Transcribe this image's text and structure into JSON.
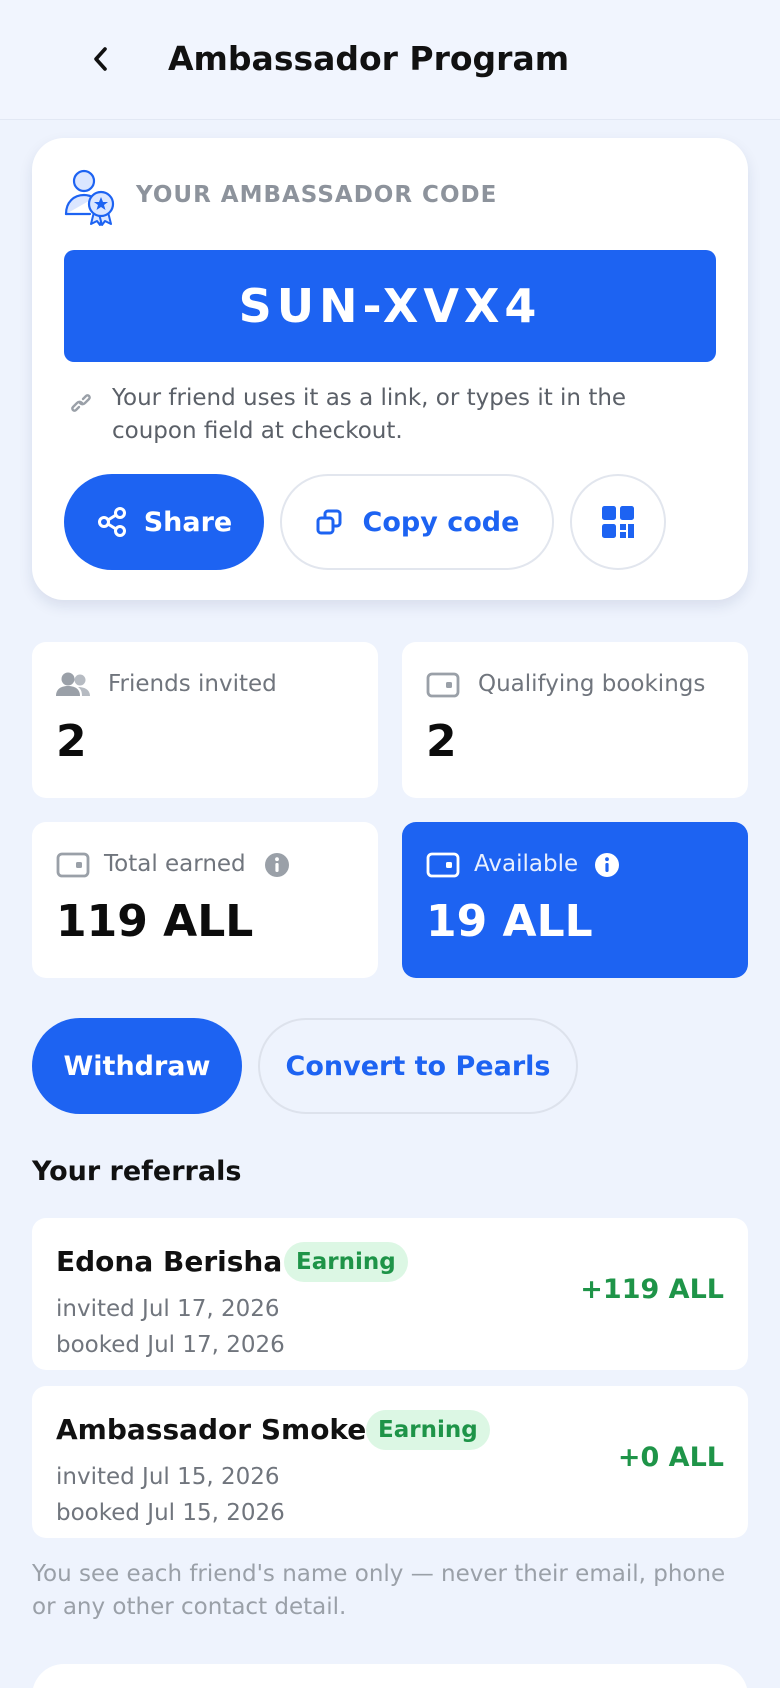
{
  "header": {
    "title": "Ambassador Program"
  },
  "code_card": {
    "label": "YOUR AMBASSADOR CODE",
    "code": "SUN-XVX4",
    "hint": "Your friend uses it as a link, or types it in the coupon field at checkout.",
    "share_label": "Share",
    "copy_label": "Copy code"
  },
  "stats": {
    "friends_invited": {
      "label": "Friends invited",
      "value": "2"
    },
    "qualifying_bookings": {
      "label": "Qualifying bookings",
      "value": "2"
    },
    "total_earned": {
      "label": "Total earned",
      "value": "119 ALL"
    },
    "available": {
      "label": "Available",
      "value": "19 ALL"
    }
  },
  "actions": {
    "withdraw_label": "Withdraw",
    "convert_label": "Convert to Pearls"
  },
  "referrals": {
    "title": "Your referrals",
    "items": [
      {
        "name": "Edona Berisha",
        "status": "Earning",
        "invited": "invited Jul 17, 2026",
        "booked": "booked Jul 17, 2026",
        "amount": "+119 ALL"
      },
      {
        "name": "Ambassador Smoke",
        "status": "Earning",
        "invited": "invited Jul 15, 2026",
        "booked": "booked Jul 15, 2026",
        "amount": "+0 ALL"
      }
    ]
  },
  "footnote": "You see each friend's name only — never their email, phone or any other contact detail.",
  "colors": {
    "accent": "#1d63f2",
    "success": "#1e9448",
    "success_bg": "#dcf7e4",
    "page_bg": "#eef3fd"
  },
  "icons": [
    "chevron-left-icon",
    "ambassador-badge-icon",
    "link-icon",
    "share-icon",
    "copy-icon",
    "qr-code-icon",
    "people-icon",
    "wallet-icon",
    "info-icon"
  ]
}
